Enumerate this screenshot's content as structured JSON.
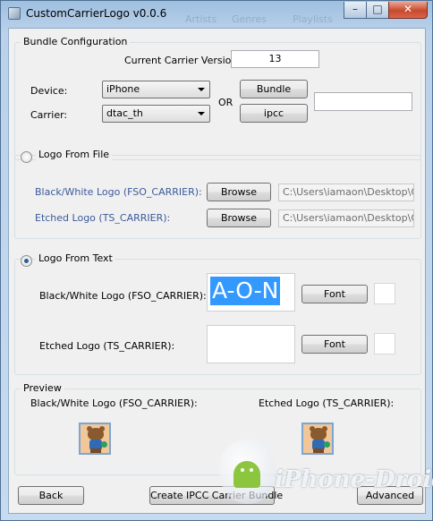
{
  "window": {
    "title": "CustomCarrierLogo v0.0.6",
    "ghost_menu": [
      "Artists",
      "Genres",
      "Playlists"
    ],
    "controls": {
      "minimize": "–",
      "maximize": "□",
      "close": "✕"
    }
  },
  "bundle": {
    "legend": "Bundle Configuration",
    "carrier_version_label": "Current Carrier Version:",
    "carrier_version_value": "13",
    "device_label": "Device:",
    "device_value": "iPhone",
    "carrier_label": "Carrier:",
    "carrier_value": "dtac_th",
    "or_label": "OR",
    "bundle_button": "Bundle",
    "ipcc_button": "ipcc",
    "path_value": ""
  },
  "logo_from_file": {
    "radio_label": "Logo From File",
    "selected": false,
    "bw_label": "Black/White Logo  (FSO_CARRIER):",
    "etched_label": "Etched Logo (TS_CARRIER):",
    "browse_label": "Browse",
    "bw_path": "C:\\Users\\iamaon\\Desktop\\Orig",
    "etched_path": "C:\\Users\\iamaon\\Desktop\\Orig"
  },
  "logo_from_text": {
    "radio_label": "Logo From Text",
    "selected": true,
    "bw_label": "Black/White Logo  (FSO_CARRIER):",
    "bw_text": "A-O-N",
    "etched_label": "Etched Logo (TS_CARRIER):",
    "etched_text": "",
    "font_button": "Font"
  },
  "preview": {
    "legend": "Preview",
    "bw_label": "Black/White Logo  (FSO_CARRIER):",
    "etched_label": "Etched Logo (TS_CARRIER):"
  },
  "footer": {
    "back_button": "Back",
    "create_button": "Create IPCC Carrier Bundle",
    "advanced_button": "Advanced"
  },
  "watermark": {
    "text": "iPhone-Droid"
  }
}
